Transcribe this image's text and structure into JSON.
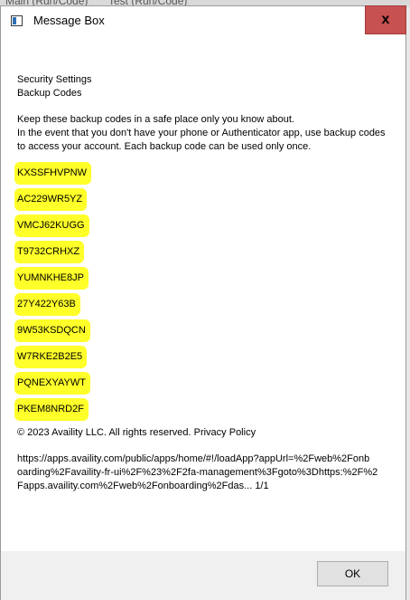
{
  "background": {
    "tab1": "Main (Run/Code)",
    "tab2": "Test (Run/Code)"
  },
  "window": {
    "title": "Message Box",
    "close_glyph": "x",
    "close_color": "#c75050"
  },
  "message": {
    "heading1": "Security Settings",
    "heading2": "Backup Codes",
    "paragraph": [
      "Keep these backup codes in a safe place only you know about.",
      "In the event that you don't have your phone or Authenticator app, use backup codes",
      "to access your account. Each backup code can be used only once."
    ],
    "codes": [
      "KXSSFHVPNW",
      "AC229WR5YZ",
      "VMCJ62KUGG",
      "T9732CRHXZ",
      "YUMNKHE8JP",
      "27Y422Y63B",
      "9W53KSDQCN",
      "W7RKE2B2E5",
      "PQNEXYAYWT",
      "PKEM8NRD2F"
    ],
    "highlight_color": "#ffff2a",
    "footer": "© 2023 Availity LLC. All rights reserved. Privacy Policy",
    "url_lines": [
      "https://apps.availity.com/public/apps/home/#!/loadApp?appUrl=%2Fweb%2Fonb",
      "oarding%2Favaility-fr-ui%2F%23%2F2fa-management%3Fgoto%3Dhttps:%2F%2",
      "Fapps.availity.com%2Fweb%2Fonboarding%2Fdas... 1/1"
    ]
  },
  "buttons": {
    "ok_label": "OK"
  }
}
